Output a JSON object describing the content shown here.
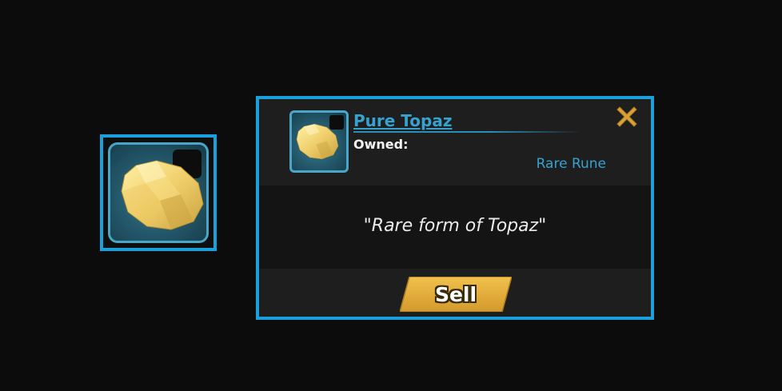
{
  "colors": {
    "background": "#0c0c0c",
    "frame_border": "#1aa0db",
    "accent_blue": "#36a2cf",
    "panel_dark": "#1c1c1c",
    "sell_gold": "#e2a93a",
    "close_gold": "#d9a239"
  },
  "inventory_slot": {
    "icon": "topaz-gem-icon"
  },
  "tooltip": {
    "item_name": "Pure Topaz",
    "owned_label": "Owned:",
    "rarity": "Rare Rune",
    "description": "\"Rare form of Topaz\"",
    "sell_label": "Sell",
    "close_icon": "close-icon",
    "thumb_icon": "topaz-gem-icon"
  }
}
